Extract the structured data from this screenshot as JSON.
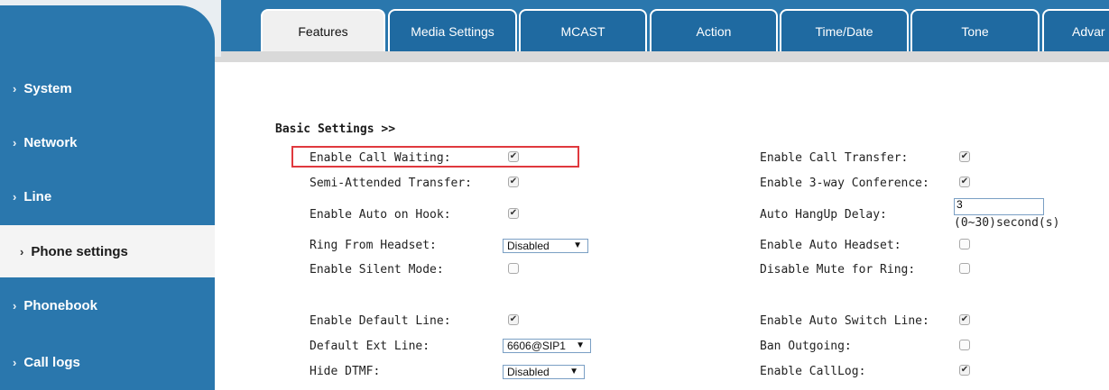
{
  "tabs": [
    {
      "label": "Features",
      "active": true
    },
    {
      "label": "Media Settings"
    },
    {
      "label": "MCAST"
    },
    {
      "label": "Action"
    },
    {
      "label": "Time/Date"
    },
    {
      "label": "Tone"
    },
    {
      "label": "Advar"
    }
  ],
  "sidebar": {
    "items": [
      {
        "label": "System"
      },
      {
        "label": "Network"
      },
      {
        "label": "Line"
      },
      {
        "label": "Phone settings",
        "active": true
      },
      {
        "label": "Phonebook"
      },
      {
        "label": "Call logs"
      }
    ],
    "chevron": "›"
  },
  "section_title": "Basic Settings >>",
  "left_rows": [
    {
      "label": "Enable Call Waiting:",
      "type": "checkbox",
      "checked": true
    },
    {
      "label": "Semi-Attended Transfer:",
      "type": "checkbox",
      "checked": true
    },
    {
      "label": "Enable Auto on Hook:",
      "type": "checkbox",
      "checked": true
    },
    {
      "label": "Ring From Headset:",
      "type": "select",
      "value": "Disabled"
    },
    {
      "label": "Enable Silent Mode:",
      "type": "checkbox",
      "checked": false
    },
    {
      "label": "Enable Default Line:",
      "type": "checkbox",
      "checked": true
    },
    {
      "label": "Default Ext Line:",
      "type": "select",
      "value": "6606@SIP1"
    },
    {
      "label": "Hide DTMF:",
      "type": "select",
      "value": "Disabled"
    }
  ],
  "right_rows": [
    {
      "label": "Enable Call Transfer:",
      "type": "checkbox",
      "checked": true
    },
    {
      "label": "Enable 3-way Conference:",
      "type": "checkbox",
      "checked": true
    },
    {
      "label": "Auto HangUp Delay:",
      "type": "text",
      "value": "3",
      "suffix": "(0~30)second(s)"
    },
    {
      "label": "Enable Auto Headset:",
      "type": "checkbox",
      "checked": false
    },
    {
      "label": "Disable Mute for Ring:",
      "type": "checkbox",
      "checked": false
    },
    {
      "label": "Enable Auto Switch Line:",
      "type": "checkbox",
      "checked": true
    },
    {
      "label": "Ban Outgoing:",
      "type": "checkbox",
      "checked": false
    },
    {
      "label": "Enable CallLog:",
      "type": "checkbox",
      "checked": true
    }
  ],
  "colors": {
    "sidebar": "#2a77ad",
    "highlight": "#e0393e"
  }
}
